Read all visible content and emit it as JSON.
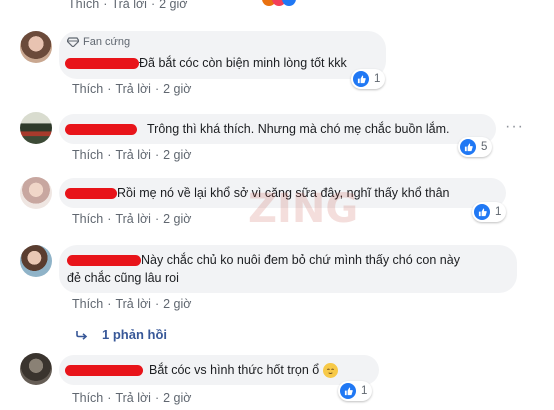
{
  "actions": {
    "like": "Thích",
    "reply": "Trả lời",
    "dot": "·",
    "time": "2 giờ"
  },
  "comments": [
    {
      "badge": "Fan cứng",
      "text": "Đã bắt cóc còn biện minh lòng tốt kkk",
      "reactions": "1"
    },
    {
      "text": "Trông thì khá thích. Nhưng mà chó mẹ chắc buồn lắm.",
      "reactions": "5"
    },
    {
      "text": "Rồi mẹ nó về lại khổ sở vì căng sữa đây, nghĩ thấy khổ thân",
      "reactions": "1"
    },
    {
      "text_line1": "Này chắc chủ ko nuôi đem bỏ chứ mình thấy chó con này",
      "text_line2": "đẻ chắc cũng lâu roi"
    },
    {
      "text": "Bắt cóc vs hình thức hốt trọn ổ",
      "reactions": "1"
    }
  ],
  "replies_link": "1 phản hồi",
  "colors": {
    "redaction": "#e8141a",
    "like_blue": "#2078f4",
    "link": "#385898",
    "meta": "#606770"
  }
}
